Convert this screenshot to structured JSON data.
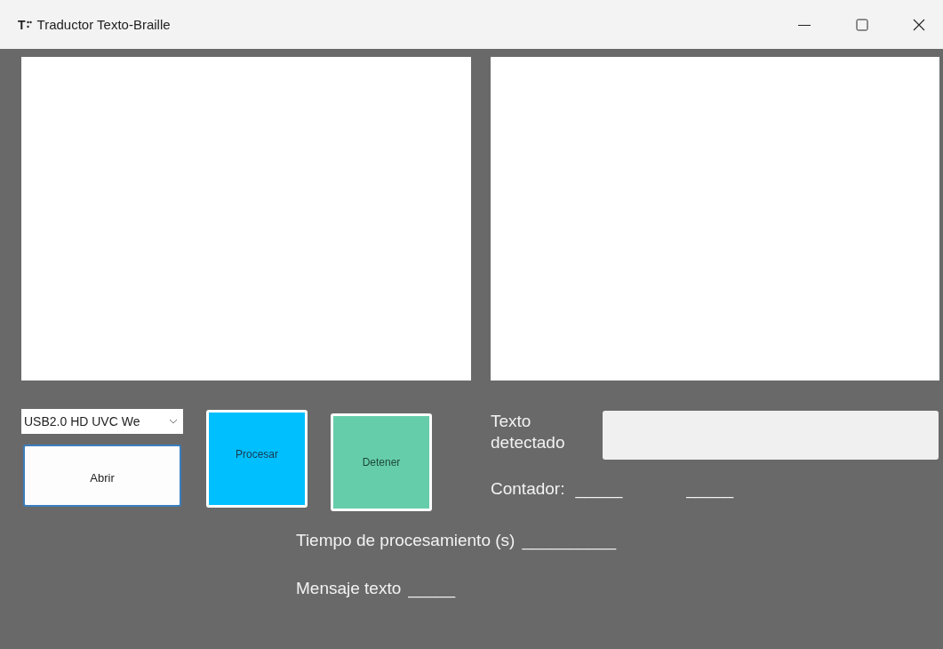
{
  "window": {
    "icon_letter": "T",
    "title": "Traductor Texto-Braille"
  },
  "camera_select": {
    "value": "USB2.0 HD UVC We"
  },
  "buttons": [
    {
      "kind": "open",
      "label": "Abrir"
    },
    {
      "kind": "process",
      "label": "Procesar"
    },
    {
      "kind": "stop",
      "label": "Detener"
    }
  ],
  "detected_text": {
    "label": "Texto detectado"
  },
  "counter": {
    "label": "Contador:",
    "values": [
      "_____",
      "_____"
    ]
  },
  "processing_time": {
    "label": "Tiempo de procesamiento (s)",
    "value": "__________"
  },
  "message": {
    "label": "Mensaje texto",
    "value": "_____"
  }
}
